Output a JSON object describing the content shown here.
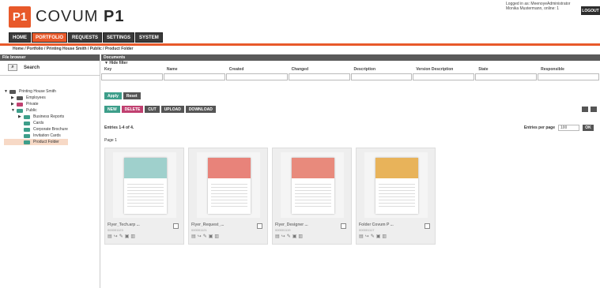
{
  "header": {
    "logo_badge": "P1",
    "logo_text_light": "COVUM",
    "logo_text_bold": "P1",
    "user_line1": "Logged in as: MeenoyeAdministrator",
    "user_line2": "Monika Mustermann, online: 1",
    "logout": "LOGOUT"
  },
  "nav": [
    "HOME",
    "PORTFOLIO",
    "REQUESTS",
    "SETTINGS",
    "SYSTEM"
  ],
  "breadcrumb": "Home / Portfolio / Printing House Smith / Public / Product Folder",
  "left": {
    "title": "File browser",
    "search": "Search",
    "tree": [
      {
        "label": "Printing House Smith",
        "indent": 0,
        "arrow": "▼",
        "color": "#555"
      },
      {
        "label": "Employees",
        "indent": 1,
        "arrow": "▶",
        "color": "#555"
      },
      {
        "label": "Private",
        "indent": 1,
        "arrow": "▶",
        "color": "#c04070"
      },
      {
        "label": "Public",
        "indent": 1,
        "arrow": "▼",
        "color": "#3d9e8a"
      },
      {
        "label": "Business Reports",
        "indent": 2,
        "arrow": "▶",
        "color": "#3d9e8a"
      },
      {
        "label": "Cards",
        "indent": 2,
        "arrow": "",
        "color": "#3d9e8a"
      },
      {
        "label": "Corporate Brochure",
        "indent": 2,
        "arrow": "",
        "color": "#3d9e8a"
      },
      {
        "label": "Invitation Cards",
        "indent": 2,
        "arrow": "",
        "color": "#3d9e8a"
      },
      {
        "label": "Product Folder",
        "indent": 2,
        "arrow": "",
        "color": "#3d9e8a",
        "selected": true
      }
    ]
  },
  "right": {
    "title": "Documents",
    "filter_toggle": "▼ Hide filter",
    "filter_labels": [
      "Key",
      "Name",
      "Created",
      "Changed",
      "Description",
      "Version Description",
      "State",
      "Responsible"
    ],
    "apply": "Apply",
    "reset": "Reset",
    "actions": [
      "NEW",
      "DELETE",
      "CUT",
      "UPLOAD",
      "DOWNLOAD"
    ],
    "entries": "Entries 1-4 of 4.",
    "per_page_label": "Entries per page",
    "per_page_value": "100",
    "ok": "OK",
    "page": "Page 1"
  },
  "cards": [
    {
      "name": "Flyer_Tech.arp ...",
      "id": "000001123",
      "band": "#9fd0cc"
    },
    {
      "name": "Flyer_Request_...",
      "id": "000001121",
      "band": "#e8837a"
    },
    {
      "name": "Flyer_Designer ...",
      "id": "000001119",
      "band": "#e88a7c"
    },
    {
      "name": "Folder Covum P ...",
      "id": "000001117",
      "band": "#e8b35a"
    }
  ]
}
